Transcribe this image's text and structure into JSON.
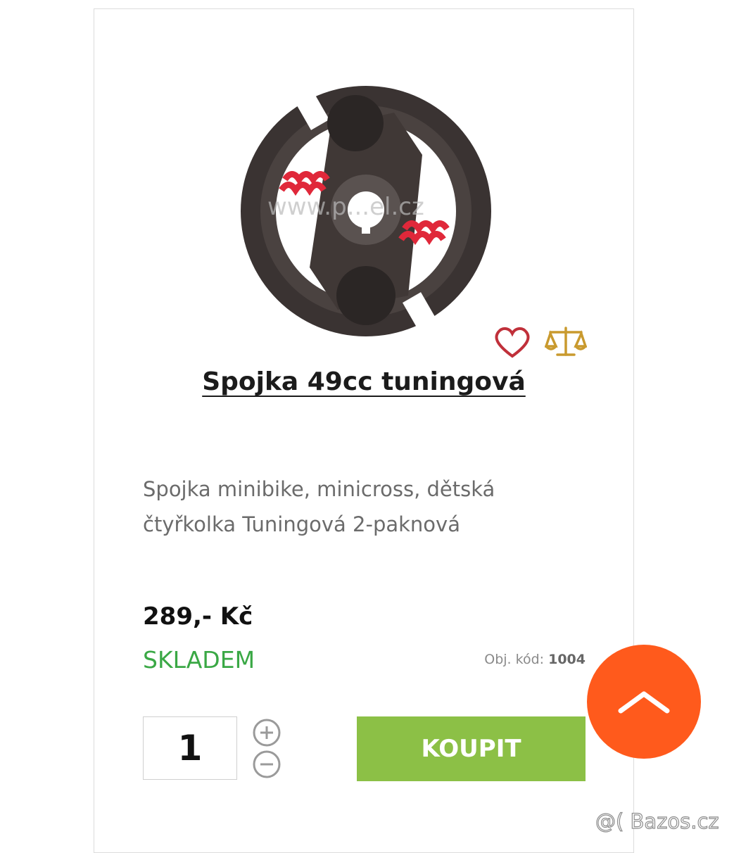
{
  "product": {
    "title": "Spojka 49cc tuningová",
    "description": "Spojka minibike, minicross, dětská čtyřkolka Tuningová 2-paknová",
    "price": "289,- Kč",
    "stock": "SKLADEM",
    "code_label": "Obj. kód:",
    "code_value": "1004",
    "image_watermark": "www.p...el.cz"
  },
  "cart": {
    "quantity": "1",
    "buy_label": "KOUPIT"
  },
  "icons": {
    "wishlist": "heart-icon",
    "compare": "scales-icon",
    "increase": "plus-circle-icon",
    "decrease": "minus-circle-icon",
    "scroll_top": "chevron-up-icon"
  },
  "watermark": "@( Bazos.cz",
  "colors": {
    "buy_button": "#8cc046",
    "stock": "#3aa845",
    "scroll_top": "#ff5a1c",
    "heart": "#c0303a",
    "compare": "#c99a2e"
  }
}
